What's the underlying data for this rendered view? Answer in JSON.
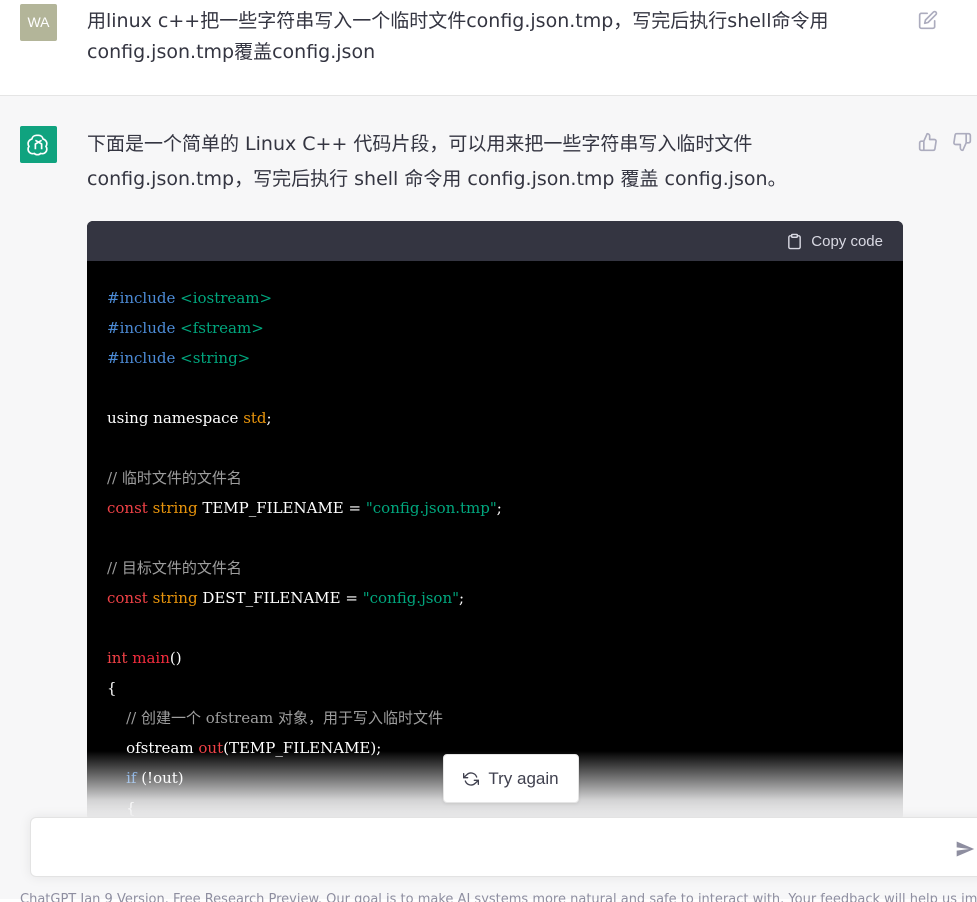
{
  "user_message": {
    "avatar_initials": "WA",
    "text": "用linux c++把一些字符串写入一个临时文件config.json.tmp，写完后执行shell命令用config.json.tmp覆盖config.json"
  },
  "assistant_message": {
    "intro": "下面是一个简单的 Linux C++ 代码片段，可以用来把一些字符串写入临时文件 config.json.tmp，写完后执行 shell 命令用 config.json.tmp 覆盖 config.json。",
    "copy_label": "Copy code",
    "code": {
      "l1_pre": "#include",
      "l1_inc": " <iostream>",
      "l2_pre": "#include",
      "l2_inc": " <fstream>",
      "l3_pre": "#include",
      "l3_inc": " <string>",
      "l5": "using namespace ",
      "l5_std": "std",
      "l5_end": ";",
      "l7_comment": "// 临时文件的文件名",
      "l8_const": "const",
      "l8_type": " string",
      "l8_name": " TEMP_FILENAME = ",
      "l8_str": "\"config.json.tmp\"",
      "l8_end": ";",
      "l10_comment": "// 目标文件的文件名",
      "l11_const": "const",
      "l11_type": " string",
      "l11_name": " DEST_FILENAME = ",
      "l11_str": "\"config.json\"",
      "l11_end": ";",
      "l13_int": "int",
      "l13_main": " main",
      "l13_end": "()",
      "l14": "{",
      "l15_comment": "    // 创建一个 ofstream 对象，用于写入临时文件",
      "l16_a": "    ofstream ",
      "l16_out": "out",
      "l16_b": "(TEMP_FILENAME);",
      "l17_if": "    if",
      "l17_b": " (!out)",
      "l18": "    {"
    }
  },
  "try_again_label": "Try again",
  "input": {
    "placeholder": ""
  },
  "footer": "ChatGPT Jan 9 Version. Free Research Preview. Our goal is to make AI systems more natural and safe to interact with. Your feedback will help us improve."
}
